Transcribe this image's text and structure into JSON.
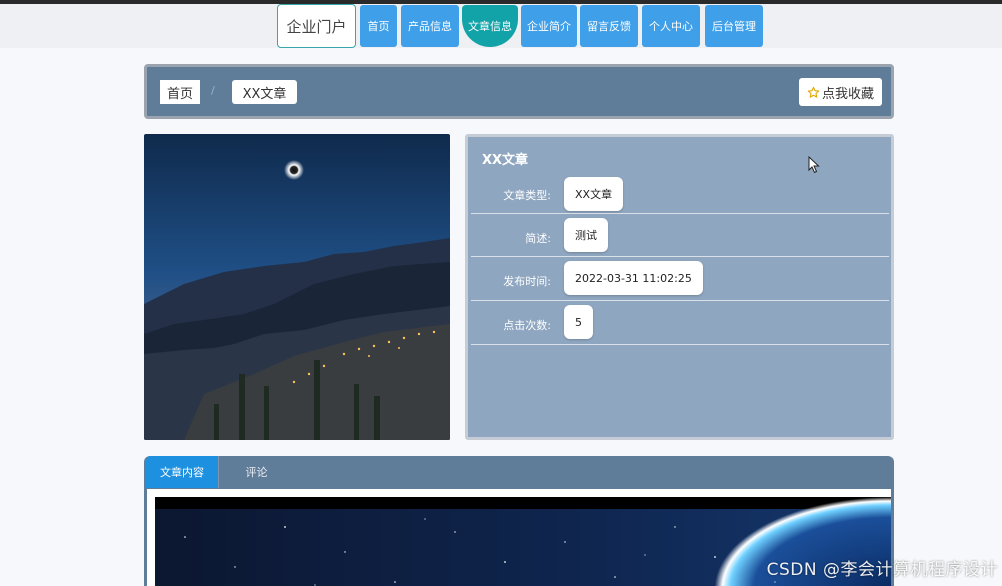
{
  "nav": {
    "brand": "企业门户",
    "items": [
      {
        "label": "首页"
      },
      {
        "label": "产品信息"
      },
      {
        "label": "文章信息",
        "active": true
      },
      {
        "label": "企业简介"
      },
      {
        "label": "留言反馈"
      },
      {
        "label": "个人中心"
      },
      {
        "label": "后台管理"
      }
    ],
    "accent": "#3f9fe8",
    "active_color": "#12a3a8"
  },
  "breadcrumb": {
    "home": "首页",
    "separator": "/",
    "current": "XX文章"
  },
  "favorite_button": {
    "label": "点我收藏",
    "icon": "star-icon"
  },
  "detail": {
    "title": "XX文章",
    "rows": [
      {
        "label": "文章类型:",
        "value": "XX文章"
      },
      {
        "label": "简述:",
        "value": "测试"
      },
      {
        "label": "发布时间:",
        "value": "2022-03-31 11:02:25"
      },
      {
        "label": "点击次数:",
        "value": "5"
      }
    ]
  },
  "tabs": [
    {
      "label": "文章内容",
      "active": true
    },
    {
      "label": "评论"
    }
  ],
  "watermark": "CSDN @李会计算机程序设计"
}
